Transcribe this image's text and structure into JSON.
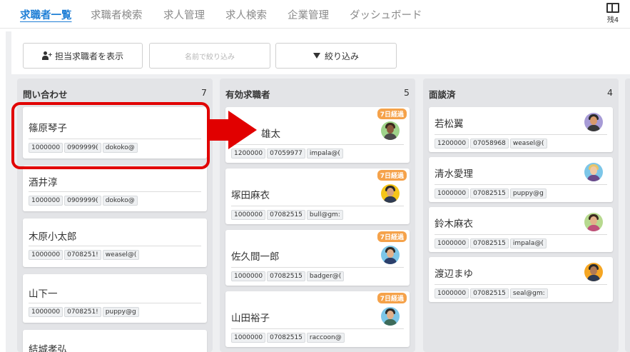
{
  "nav": {
    "items": [
      "求職者一覧",
      "求職者検索",
      "求人管理",
      "求人検索",
      "企業管理",
      "ダッシュボード"
    ],
    "quota_label": "残4"
  },
  "toolbar": {
    "assigned_label": "担当求職者を表示",
    "name_filter_placeholder": "名前で絞り込み",
    "filter_label": "絞り込み"
  },
  "columns": [
    {
      "title": "問い合わせ",
      "count": "7",
      "cards": [
        {
          "name": "篠原琴子",
          "chips": [
            "1000000",
            "0909999(",
            "dokoko@"
          ]
        },
        {
          "name": "酒井淳",
          "chips": [
            "1000000",
            "0909999(",
            "dokoko@"
          ]
        },
        {
          "name": "木原小太郎",
          "chips": [
            "1000000",
            "0708251!",
            "weasel@("
          ]
        },
        {
          "name": "山下一",
          "chips": [
            "1000000",
            "0708251!",
            "puppy@g"
          ]
        },
        {
          "name": "結城孝弘",
          "chips": []
        }
      ]
    },
    {
      "title": "有効求職者",
      "count": "5",
      "cards": [
        {
          "name": "雄太",
          "badge": "7日経過",
          "chips": [
            "1200000",
            "07059977",
            "impala@("
          ]
        },
        {
          "name": "塚田麻衣",
          "badge": "7日経過",
          "chips": [
            "1000000",
            "07082515",
            "bull@gm:"
          ]
        },
        {
          "name": "佐久間一郎",
          "badge": "7日経過",
          "chips": [
            "1000000",
            "07082515",
            "badger@("
          ]
        },
        {
          "name": "山田裕子",
          "badge": "7日経過",
          "chips": [
            "1000000",
            "07082515",
            "raccoon@"
          ]
        }
      ]
    },
    {
      "title": "面談済",
      "count": "4",
      "cards": [
        {
          "name": "若松翼",
          "chips": [
            "1200000",
            "07058968",
            "weasel@("
          ]
        },
        {
          "name": "清水愛理",
          "chips": [
            "1000000",
            "07082515",
            "puppy@g"
          ]
        },
        {
          "name": "鈴木麻衣",
          "chips": [
            "1000000",
            "07082515",
            "impala@("
          ]
        },
        {
          "name": "渡辺まゆ",
          "chips": [
            "1000000",
            "07082515",
            "seal@gm:"
          ]
        }
      ]
    }
  ],
  "colors": {
    "accent": "#1f7fd6",
    "highlight": "#e10000",
    "badge": "#f5a24a",
    "column_bg": "#e3e4e7"
  }
}
